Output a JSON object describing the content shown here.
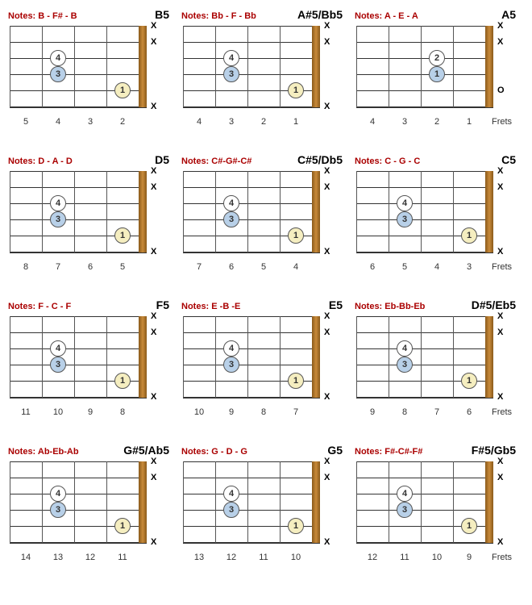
{
  "labels": {
    "notes_prefix": "Notes:",
    "frets_word": "Frets"
  },
  "chords": [
    {
      "name": "B5",
      "notes": "B - F# - B",
      "fret_numbers": [
        "5",
        "4",
        "3",
        "2"
      ],
      "show_frets_word": false,
      "strings": [
        "X",
        "X",
        "",
        "",
        "",
        "X"
      ],
      "dots": [
        {
          "row": 2,
          "col": 1,
          "finger": "4",
          "color": "white"
        },
        {
          "row": 3,
          "col": 1,
          "finger": "3",
          "color": "blue"
        },
        {
          "row": 4,
          "col": 3,
          "finger": "1",
          "color": "yellow"
        }
      ]
    },
    {
      "name": "A#5/Bb5",
      "notes": "Bb - F - Bb",
      "fret_numbers": [
        "4",
        "3",
        "2",
        "1"
      ],
      "show_frets_word": false,
      "strings": [
        "X",
        "X",
        "",
        "",
        "",
        "X"
      ],
      "dots": [
        {
          "row": 2,
          "col": 1,
          "finger": "4",
          "color": "white"
        },
        {
          "row": 3,
          "col": 1,
          "finger": "3",
          "color": "blue"
        },
        {
          "row": 4,
          "col": 3,
          "finger": "1",
          "color": "yellow"
        }
      ]
    },
    {
      "name": "A5",
      "notes": "A - E - A",
      "fret_numbers": [
        "4",
        "3",
        "2",
        "1"
      ],
      "show_frets_word": true,
      "strings": [
        "X",
        "X",
        "",
        "",
        "O",
        ""
      ],
      "dots": [
        {
          "row": 2,
          "col": 2,
          "finger": "2",
          "color": "white"
        },
        {
          "row": 3,
          "col": 2,
          "finger": "1",
          "color": "blue"
        }
      ]
    },
    {
      "name": "D5",
      "notes": "D - A - D",
      "fret_numbers": [
        "8",
        "7",
        "6",
        "5"
      ],
      "show_frets_word": false,
      "strings": [
        "X",
        "X",
        "",
        "",
        "",
        "X"
      ],
      "dots": [
        {
          "row": 2,
          "col": 1,
          "finger": "4",
          "color": "white"
        },
        {
          "row": 3,
          "col": 1,
          "finger": "3",
          "color": "blue"
        },
        {
          "row": 4,
          "col": 3,
          "finger": "1",
          "color": "yellow"
        }
      ]
    },
    {
      "name": "C#5/Db5",
      "notes": "C#-G#-C#",
      "fret_numbers": [
        "7",
        "6",
        "5",
        "4"
      ],
      "show_frets_word": false,
      "strings": [
        "X",
        "X",
        "",
        "",
        "",
        "X"
      ],
      "dots": [
        {
          "row": 2,
          "col": 1,
          "finger": "4",
          "color": "white"
        },
        {
          "row": 3,
          "col": 1,
          "finger": "3",
          "color": "blue"
        },
        {
          "row": 4,
          "col": 3,
          "finger": "1",
          "color": "yellow"
        }
      ]
    },
    {
      "name": "C5",
      "notes": "C - G - C",
      "fret_numbers": [
        "6",
        "5",
        "4",
        "3"
      ],
      "show_frets_word": true,
      "strings": [
        "X",
        "X",
        "",
        "",
        "",
        "X"
      ],
      "dots": [
        {
          "row": 2,
          "col": 1,
          "finger": "4",
          "color": "white"
        },
        {
          "row": 3,
          "col": 1,
          "finger": "3",
          "color": "blue"
        },
        {
          "row": 4,
          "col": 3,
          "finger": "1",
          "color": "yellow"
        }
      ]
    },
    {
      "name": "F5",
      "notes": "F - C - F",
      "fret_numbers": [
        "11",
        "10",
        "9",
        "8"
      ],
      "show_frets_word": false,
      "strings": [
        "X",
        "X",
        "",
        "",
        "",
        "X"
      ],
      "dots": [
        {
          "row": 2,
          "col": 1,
          "finger": "4",
          "color": "white"
        },
        {
          "row": 3,
          "col": 1,
          "finger": "3",
          "color": "blue"
        },
        {
          "row": 4,
          "col": 3,
          "finger": "1",
          "color": "yellow"
        }
      ]
    },
    {
      "name": "E5",
      "notes": "E -B -E",
      "fret_numbers": [
        "10",
        "9",
        "8",
        "7"
      ],
      "show_frets_word": false,
      "strings": [
        "X",
        "X",
        "",
        "",
        "",
        "X"
      ],
      "dots": [
        {
          "row": 2,
          "col": 1,
          "finger": "4",
          "color": "white"
        },
        {
          "row": 3,
          "col": 1,
          "finger": "3",
          "color": "blue"
        },
        {
          "row": 4,
          "col": 3,
          "finger": "1",
          "color": "yellow"
        }
      ]
    },
    {
      "name": "D#5/Eb5",
      "notes": "Eb-Bb-Eb",
      "fret_numbers": [
        "9",
        "8",
        "7",
        "6"
      ],
      "show_frets_word": true,
      "strings": [
        "X",
        "X",
        "",
        "",
        "",
        "X"
      ],
      "dots": [
        {
          "row": 2,
          "col": 1,
          "finger": "4",
          "color": "white"
        },
        {
          "row": 3,
          "col": 1,
          "finger": "3",
          "color": "blue"
        },
        {
          "row": 4,
          "col": 3,
          "finger": "1",
          "color": "yellow"
        }
      ]
    },
    {
      "name": "G#5/Ab5",
      "notes": "Ab-Eb-Ab",
      "fret_numbers": [
        "14",
        "13",
        "12",
        "11"
      ],
      "show_frets_word": false,
      "strings": [
        "X",
        "X",
        "",
        "",
        "",
        "X"
      ],
      "dots": [
        {
          "row": 2,
          "col": 1,
          "finger": "4",
          "color": "white"
        },
        {
          "row": 3,
          "col": 1,
          "finger": "3",
          "color": "blue"
        },
        {
          "row": 4,
          "col": 3,
          "finger": "1",
          "color": "yellow"
        }
      ]
    },
    {
      "name": "G5",
      "notes": "G - D - G",
      "fret_numbers": [
        "13",
        "12",
        "11",
        "10"
      ],
      "show_frets_word": false,
      "strings": [
        "X",
        "X",
        "",
        "",
        "",
        "X"
      ],
      "dots": [
        {
          "row": 2,
          "col": 1,
          "finger": "4",
          "color": "white"
        },
        {
          "row": 3,
          "col": 1,
          "finger": "3",
          "color": "blue"
        },
        {
          "row": 4,
          "col": 3,
          "finger": "1",
          "color": "yellow"
        }
      ]
    },
    {
      "name": "F#5/Gb5",
      "notes": "F#-C#-F#",
      "fret_numbers": [
        "12",
        "11",
        "10",
        "9"
      ],
      "show_frets_word": true,
      "strings": [
        "X",
        "X",
        "",
        "",
        "",
        "X"
      ],
      "dots": [
        {
          "row": 2,
          "col": 1,
          "finger": "4",
          "color": "white"
        },
        {
          "row": 3,
          "col": 1,
          "finger": "3",
          "color": "blue"
        },
        {
          "row": 4,
          "col": 3,
          "finger": "1",
          "color": "yellow"
        }
      ]
    }
  ]
}
